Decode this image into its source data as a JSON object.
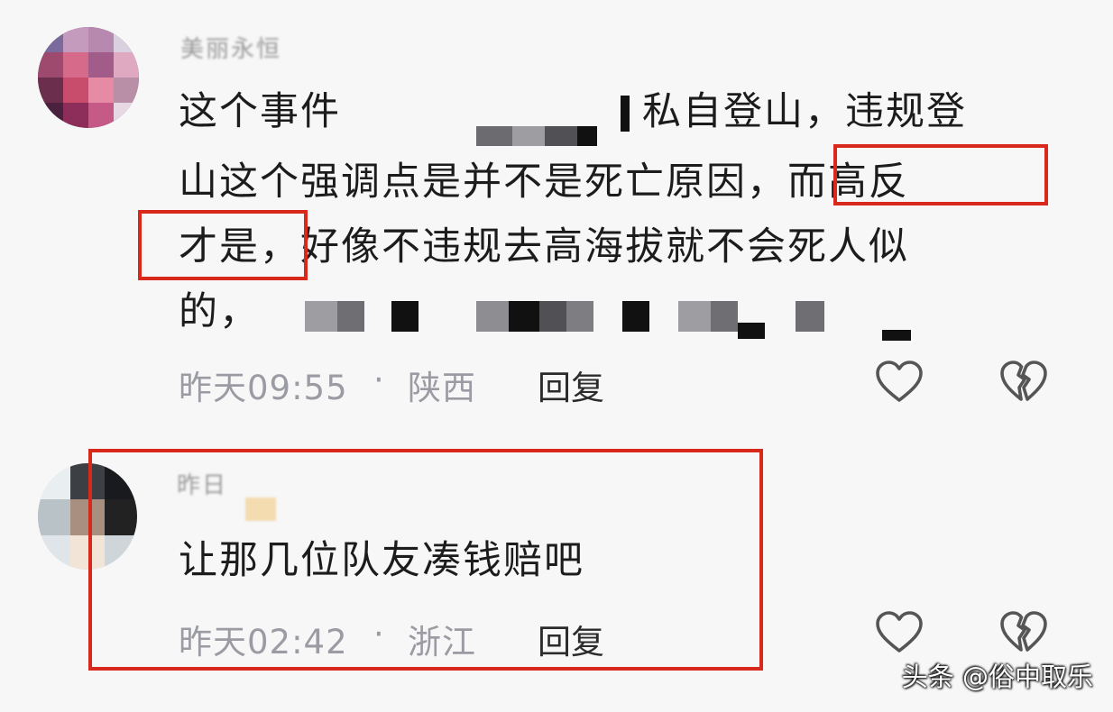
{
  "comments": [
    {
      "avatar_icon": "user-avatar",
      "username": "美丽永恒",
      "lines": [
        "这个事件",
        "私自登山，违规登",
        "山这个强调点是并不是死亡原因，而高反",
        "才是，好像不违规去高海拔就不会死人似",
        "的，"
      ],
      "time": "昨天09:55",
      "separator": "·",
      "location": "陕西",
      "reply_label": "回复"
    },
    {
      "avatar_icon": "user-avatar",
      "username": "昨日",
      "text": "让那几位队友凑钱赔吧",
      "time": "昨天02:42",
      "separator": "·",
      "location": "浙江",
      "reply_label": "回复"
    }
  ],
  "watermark": "头条 @俗中取乐",
  "colors": {
    "highlight_box": "#d9281c",
    "meta_text": "#9b9ba3",
    "body_text": "#1c1c1c"
  }
}
